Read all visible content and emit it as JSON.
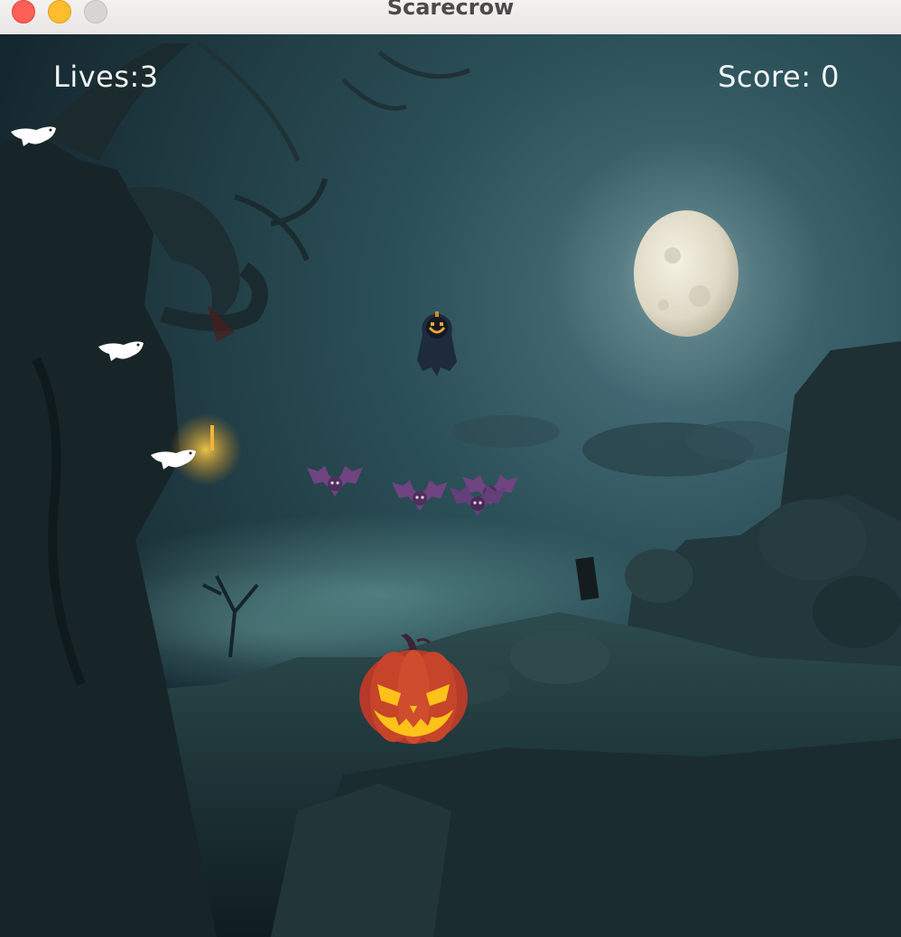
{
  "window": {
    "title": "Scarecrow"
  },
  "hud": {
    "lives_label": "Lives:3",
    "score_label": "Score: 0"
  },
  "colors": {
    "sky": "#1f3c44",
    "moon": "#e9e6d8",
    "pumpkin": "#c6442a",
    "bat": "#7a4b87",
    "ghost": "#ffffff"
  },
  "entities": {
    "ghosts": [
      "ghost-sprite",
      "ghost-sprite",
      "ghost-sprite"
    ],
    "bats": [
      "bat-sprite",
      "bat-sprite",
      "bat-sprite",
      "bat-sprite"
    ],
    "scarecrow": "hooded-pumpkin-sprite",
    "player": "jack-o-lantern-sprite"
  }
}
